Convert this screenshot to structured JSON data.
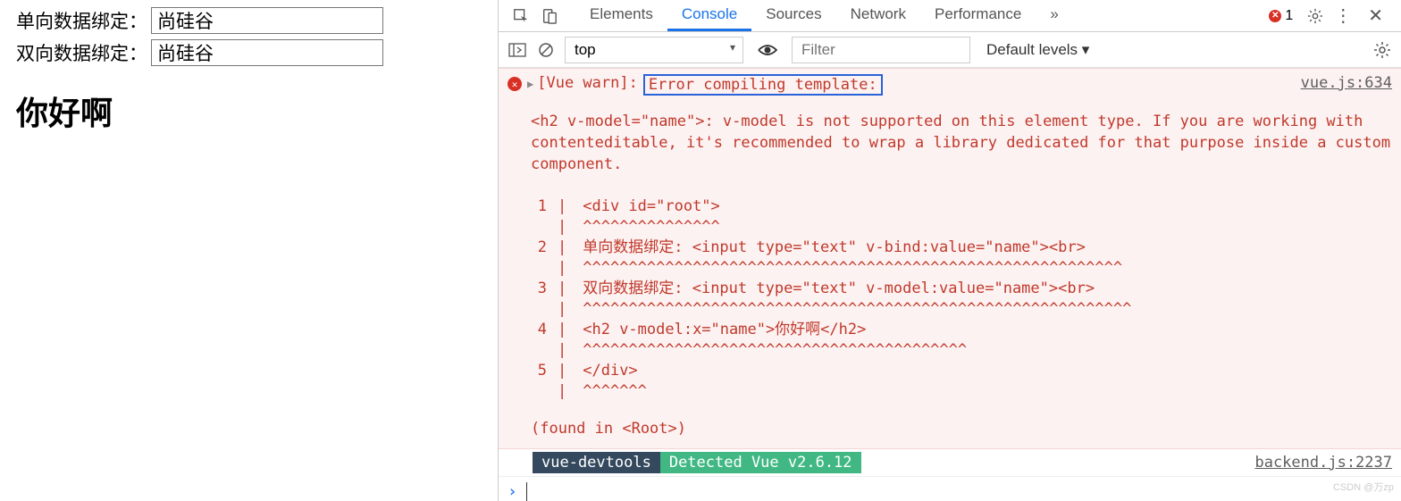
{
  "webpage": {
    "label1": "单向数据绑定：",
    "value1": "尚硅谷",
    "label2": "双向数据绑定：",
    "value2": "尚硅谷",
    "greeting": "你好啊"
  },
  "devtools": {
    "tabs": [
      "Elements",
      "Console",
      "Sources",
      "Network",
      "Performance"
    ],
    "active_tab": "Console",
    "more_tabs": "»",
    "error_count": "1",
    "toolbar": {
      "context": "top",
      "filter_placeholder": "Filter",
      "levels": "Default levels ▾"
    },
    "console": {
      "warn_prefix": "[Vue warn]:",
      "error_title": "Error compiling template:",
      "source1": "vue.js:634",
      "body_text": "<h2 v-model=\"name\">: v-model is not supported on this element type. If you are working with contenteditable, it's recommended to wrap a library dedicated for that purpose inside a custom component.",
      "code_lines": [
        {
          "n": "1",
          "code": "   <div id=\"root\">",
          "carets": "   ^^^^^^^^^^^^^^^"
        },
        {
          "n": "2",
          "code": "           单向数据绑定: <input type=\"text\" v-bind:value=\"name\"><br>",
          "carets": "   ^^^^^^^^^^^^^^^^^^^^^^^^^^^^^^^^^^^^^^^^^^^^^^^^^^^^^^^^^^^"
        },
        {
          "n": "3",
          "code": "           双向数据绑定: <input type=\"text\" v-model:value=\"name\"><br>",
          "carets": "   ^^^^^^^^^^^^^^^^^^^^^^^^^^^^^^^^^^^^^^^^^^^^^^^^^^^^^^^^^^^^"
        },
        {
          "n": "4",
          "code": "           <h2 v-model:x=\"name\">你好啊</h2>",
          "carets": "   ^^^^^^^^^^^^^^^^^^^^^^^^^^^^^^^^^^^^^^^^^^"
        },
        {
          "n": "5",
          "code": "       </div>",
          "carets": "   ^^^^^^^"
        }
      ],
      "found_in": "(found in <Root>)",
      "vue_tools": "vue-devtools",
      "vue_detected": " Detected Vue v2.6.12 ",
      "source2": "backend.js:2237"
    }
  },
  "watermark": "CSDN @万zp"
}
